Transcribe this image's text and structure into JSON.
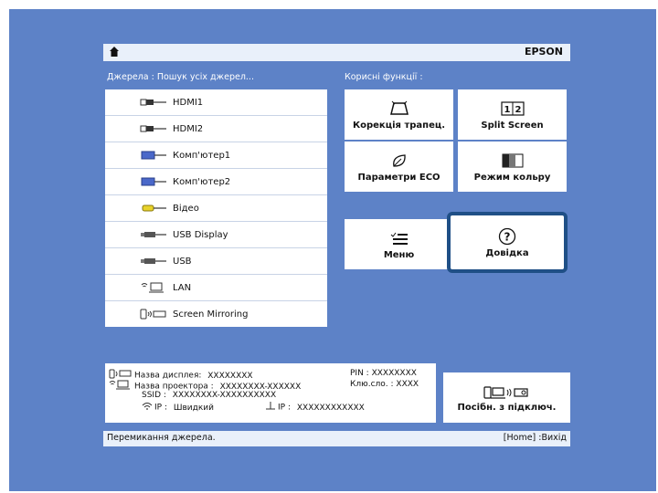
{
  "header": {
    "brand": "EPSON",
    "home_icon": "home-icon"
  },
  "sources": {
    "label": "Джерела : Пошук усіх джерел...",
    "items": [
      {
        "label": "HDMI1",
        "icon": "hdmi-icon"
      },
      {
        "label": "HDMI2",
        "icon": "hdmi-icon"
      },
      {
        "label": "Комп'ютер1",
        "icon": "computer-icon"
      },
      {
        "label": "Комп'ютер2",
        "icon": "computer-icon"
      },
      {
        "label": "Відео",
        "icon": "video-icon"
      },
      {
        "label": "USB Display",
        "icon": "usb-display-icon"
      },
      {
        "label": "USB",
        "icon": "usb-icon"
      },
      {
        "label": "LAN",
        "icon": "lan-icon"
      },
      {
        "label": "Screen Mirroring",
        "icon": "screen-mirroring-icon"
      }
    ]
  },
  "functions": {
    "label": "Корисні функції :",
    "keystone": "Корекція трапец.",
    "split": "Split Screen",
    "eco": "Параметри ECO",
    "color": "Режим кольру",
    "menu": "Меню",
    "help": "Довідка",
    "split_digits": "1 2"
  },
  "info": {
    "display_name_label": "Назва дисплея:",
    "display_name_value": "XXXXXXXX",
    "pin_label": "PIN :",
    "pin_value": "XXXXXXXX",
    "projector_name_label": "Назва проектора :",
    "projector_name_value": "XXXXXXXX-XXXXXX",
    "key_label": "Клю.сло. :",
    "key_value": "XXXX",
    "ssid_label": "SSID :",
    "ssid_value": "XXXXXXXX-XXXXXXXXXX",
    "ip_left_label": "IP :",
    "ip_left_value": "Швидкий",
    "ip_right_label": "IP :",
    "ip_right_value": "XXXXXXXXXXXX"
  },
  "connect_button": {
    "label": "Посібн. з підключ."
  },
  "status": {
    "left": "Перемикання джерела.",
    "right": "[Home] :Вихід"
  },
  "colors": {
    "background": "#5d82c7",
    "selection": "#1f4f86",
    "bar": "#e9f0fa"
  }
}
